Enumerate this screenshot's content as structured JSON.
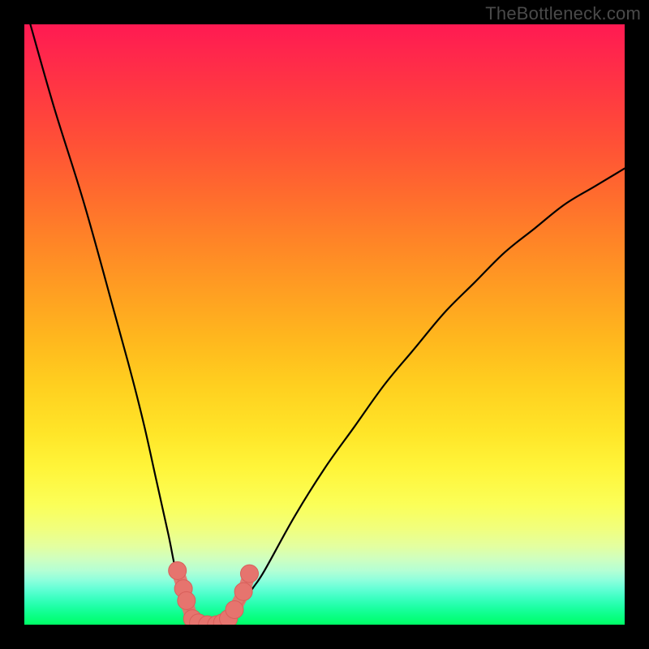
{
  "watermark": "TheBottleneck.com",
  "colors": {
    "frame": "#000000",
    "curve": "#000000",
    "marker_fill": "#e6746e",
    "marker_stroke": "#d85f5a"
  },
  "chart_data": {
    "type": "line",
    "title": "",
    "xlabel": "",
    "ylabel": "",
    "xlim": [
      0,
      100
    ],
    "ylim": [
      0,
      100
    ],
    "grid": false,
    "legend": false,
    "series": [
      {
        "name": "bottleneck-curve",
        "note": "V-shaped curve; y is bottleneck percentage (0=green, 100=red). Minimum around x≈28–35.",
        "x": [
          1,
          5,
          10,
          15,
          18,
          20,
          22,
          24,
          25,
          26,
          27,
          28,
          29,
          30,
          31,
          32,
          33,
          34,
          35,
          36,
          38,
          40,
          45,
          50,
          55,
          60,
          65,
          70,
          75,
          80,
          85,
          90,
          95,
          100
        ],
        "y": [
          100,
          86,
          70,
          52,
          41,
          33,
          24,
          15,
          10,
          6,
          3,
          1,
          0,
          0,
          0,
          0,
          0.5,
          1,
          2,
          3,
          6,
          9,
          18,
          26,
          33,
          40,
          46,
          52,
          57,
          62,
          66,
          70,
          73,
          76
        ]
      }
    ],
    "markers": {
      "name": "highlighted-points",
      "note": "Salmon dots near the curve minimum, with a connecting salmon polyline.",
      "points": [
        {
          "x": 25.5,
          "y": 9.0
        },
        {
          "x": 26.5,
          "y": 6.0
        },
        {
          "x": 27.0,
          "y": 4.0
        },
        {
          "x": 28.0,
          "y": 1.0
        },
        {
          "x": 29.0,
          "y": 0.3
        },
        {
          "x": 30.5,
          "y": 0.0
        },
        {
          "x": 32.0,
          "y": 0.0
        },
        {
          "x": 33.0,
          "y": 0.3
        },
        {
          "x": 34.0,
          "y": 1.0
        },
        {
          "x": 35.0,
          "y": 2.5
        },
        {
          "x": 36.5,
          "y": 5.5
        },
        {
          "x": 37.5,
          "y": 8.5
        }
      ]
    }
  }
}
